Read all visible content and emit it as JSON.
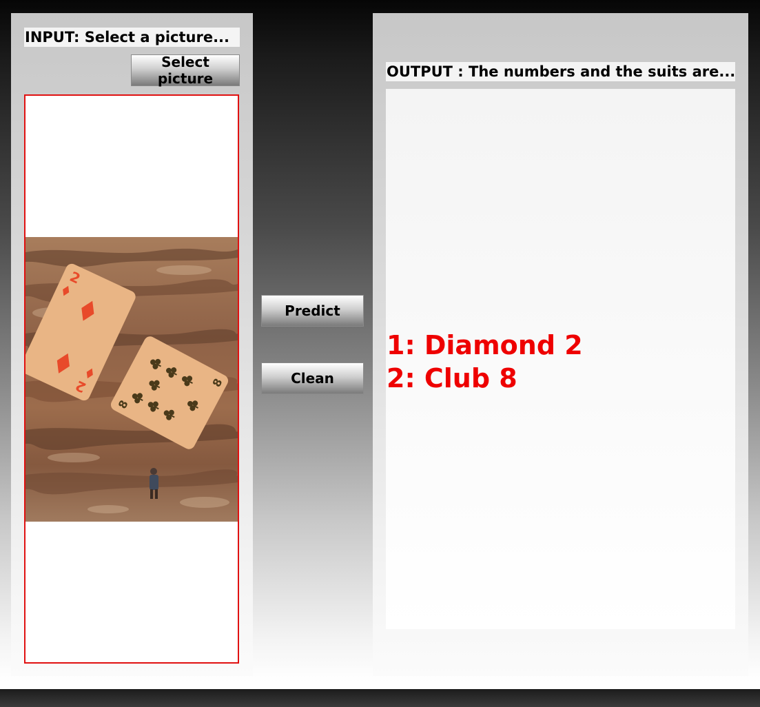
{
  "input_panel": {
    "heading": "INPUT: Select a picture...",
    "select_button_label": "Select picture"
  },
  "actions": {
    "predict_label": "Predict",
    "clean_label": "Clean"
  },
  "output_panel": {
    "heading": "OUTPUT : The numbers and the suits are...",
    "results": [
      "1: Diamond 2",
      "2: Club 8"
    ]
  },
  "picture": {
    "cards": [
      {
        "rank": "2",
        "suit": "diamond"
      },
      {
        "rank": "8",
        "suit": "club"
      }
    ]
  },
  "colors": {
    "result_text": "#ee0000",
    "frame_border": "#e01010",
    "diamond": "#e84a2a",
    "club": "#4a3a1a",
    "card_face": "#e9b585"
  }
}
